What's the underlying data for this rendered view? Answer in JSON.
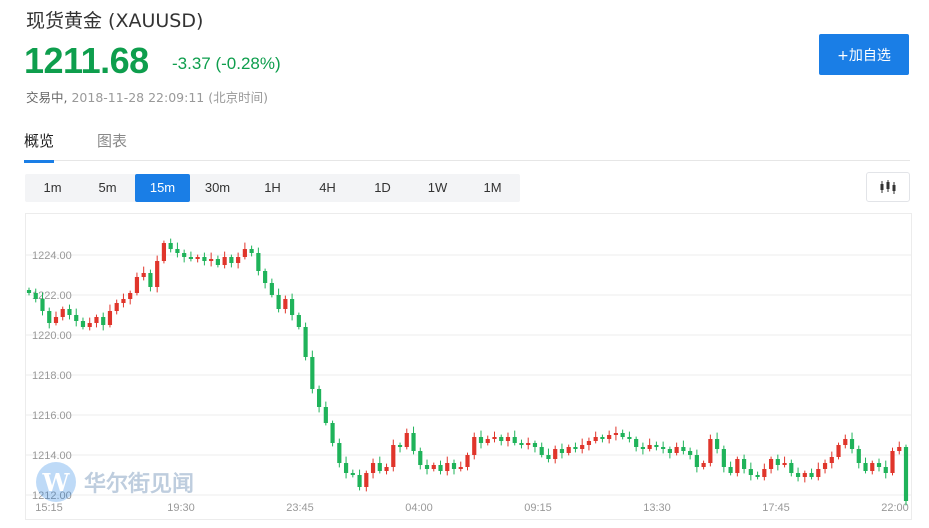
{
  "header": {
    "title": "现货黄金 (XAUUSD)",
    "price": "1211.68",
    "change": "-3.37 (-0.28%)",
    "status_label": "交易中,",
    "timestamp": "2018-11-28 22:09:11 (北京时间)",
    "add_button": "+加自选"
  },
  "tabs": [
    {
      "label": "概览",
      "active": true
    },
    {
      "label": "图表",
      "active": false
    }
  ],
  "periods": [
    {
      "label": "1m",
      "active": false
    },
    {
      "label": "5m",
      "active": false
    },
    {
      "label": "15m",
      "active": true
    },
    {
      "label": "30m",
      "active": false
    },
    {
      "label": "1H",
      "active": false
    },
    {
      "label": "4H",
      "active": false
    },
    {
      "label": "1D",
      "active": false
    },
    {
      "label": "1W",
      "active": false
    },
    {
      "label": "1M",
      "active": false
    }
  ],
  "chart_type_icon": "candlestick-icon",
  "watermark": {
    "logo": "W",
    "text": "华尔街见闻"
  },
  "colors": {
    "up": "#e0352b",
    "down": "#1fb35a",
    "accent": "#1a7ee6",
    "price": "#0e9e4d"
  },
  "chart_data": {
    "type": "candlestick",
    "ylim": [
      1212.0,
      1226.0
    ],
    "y_ticks": [
      "1212.00",
      "1214.00",
      "1216.00",
      "1218.00",
      "1220.00",
      "1222.00",
      "1224.00"
    ],
    "x_ticks": [
      "15:15",
      "19:30",
      "23:45",
      "04:00",
      "09:15",
      "13:30",
      "17:45",
      "22:00"
    ],
    "closes": [
      1222.1,
      1221.8,
      1221.2,
      1220.6,
      1220.9,
      1221.3,
      1221.0,
      1220.7,
      1220.4,
      1220.6,
      1220.9,
      1220.5,
      1221.2,
      1221.6,
      1221.8,
      1222.1,
      1222.9,
      1223.1,
      1222.4,
      1223.7,
      1224.6,
      1224.3,
      1224.1,
      1223.9,
      1223.8,
      1223.9,
      1223.7,
      1223.8,
      1223.5,
      1223.9,
      1223.6,
      1223.9,
      1224.3,
      1224.1,
      1223.2,
      1222.6,
      1222.0,
      1221.3,
      1221.8,
      1221.0,
      1220.4,
      1218.9,
      1217.3,
      1216.4,
      1215.6,
      1214.6,
      1213.6,
      1213.1,
      1213.0,
      1212.4,
      1213.1,
      1213.6,
      1213.2,
      1213.4,
      1214.5,
      1214.4,
      1215.1,
      1214.2,
      1213.5,
      1213.3,
      1213.5,
      1213.2,
      1213.6,
      1213.3,
      1213.4,
      1214.0,
      1214.9,
      1214.6,
      1214.8,
      1214.9,
      1214.7,
      1214.9,
      1214.6,
      1214.5,
      1214.6,
      1214.4,
      1214.0,
      1213.8,
      1214.3,
      1214.1,
      1214.4,
      1214.3,
      1214.5,
      1214.7,
      1214.9,
      1214.8,
      1215.0,
      1215.1,
      1214.9,
      1214.8,
      1214.4,
      1214.3,
      1214.5,
      1214.4,
      1214.3,
      1214.1,
      1214.4,
      1214.2,
      1214.0,
      1213.4,
      1213.6,
      1214.8,
      1214.3,
      1213.4,
      1213.1,
      1213.8,
      1213.3,
      1213.0,
      1212.9,
      1213.3,
      1213.8,
      1213.5,
      1213.6,
      1213.1,
      1212.9,
      1213.1,
      1212.9,
      1213.3,
      1213.6,
      1213.9,
      1214.5,
      1214.8,
      1214.3,
      1213.6,
      1213.2,
      1213.6,
      1213.4,
      1213.1,
      1214.2,
      1214.4,
      1211.7
    ]
  }
}
